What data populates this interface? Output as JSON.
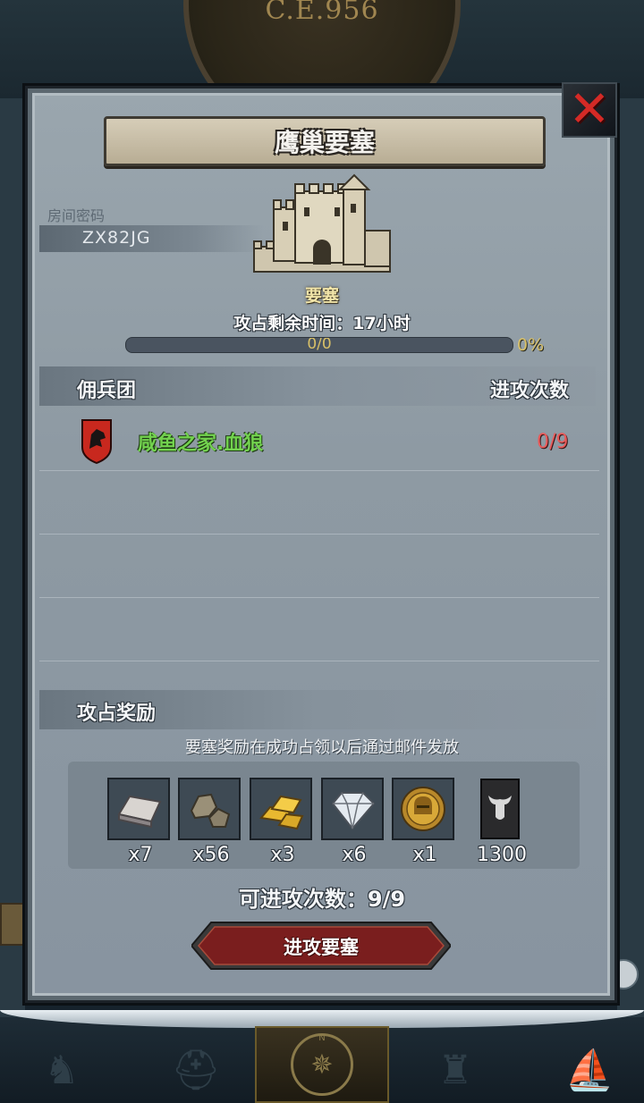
{
  "era": "C.E.956",
  "dialog": {
    "title": "鹰巢要塞",
    "close_icon": "close-x-icon"
  },
  "room": {
    "label": "房间密码",
    "code": "ZX82JG"
  },
  "fortress": {
    "type_label": "要塞",
    "time_remaining": "攻占剩余时间：17小时",
    "progress_text": "0/0",
    "progress_percent": "0%",
    "progress_value": 0
  },
  "mercenary": {
    "section_title": "佣兵团",
    "column_attacks": "进攻次数",
    "rows": [
      {
        "name": "咸鱼之家.血狼",
        "attacks": "0/9",
        "emblem": "wolf-shield-icon"
      }
    ]
  },
  "rewards": {
    "section_title": "攻占奖励",
    "note": "要塞奖励在成功占领以后通过邮件发放",
    "items": [
      {
        "icon": "iron-ingot-icon",
        "qty": "x7"
      },
      {
        "icon": "stone-icon",
        "qty": "x56"
      },
      {
        "icon": "gold-bars-icon",
        "qty": "x3"
      },
      {
        "icon": "diamond-icon",
        "qty": "x6"
      },
      {
        "icon": "helmet-medal-icon",
        "qty": "x1"
      },
      {
        "icon": "bull-banner-icon",
        "qty": "1300"
      }
    ]
  },
  "attack_count": "可进攻次数：9/9",
  "attack_button": "进攻要塞",
  "colors": {
    "guild_name": "#72d24e",
    "attack_count_red": "#e85a5a",
    "progress_gold": "#d8c068",
    "close_red": "#d42a26",
    "button_red": "#7a1e1e"
  }
}
